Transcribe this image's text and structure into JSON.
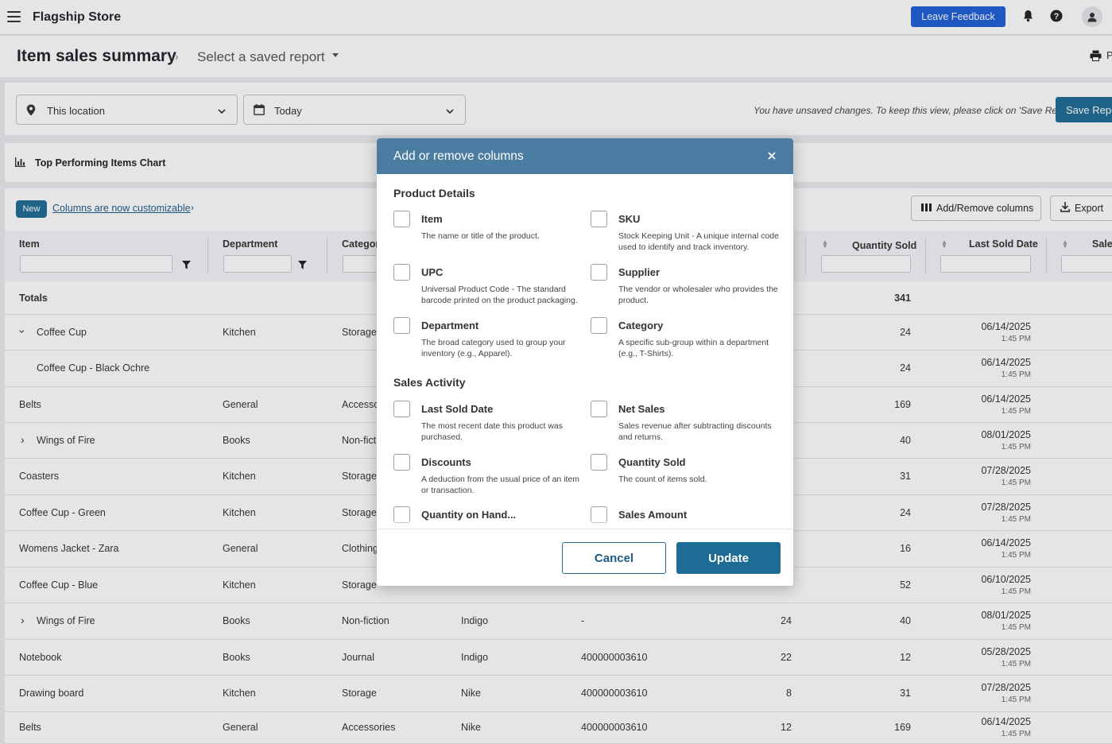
{
  "topbar": {
    "store_name": "Flagship Store",
    "feedback_label": "Leave Feedback",
    "icons": [
      "menu-icon",
      "bell-icon",
      "help-icon",
      "user-icon"
    ]
  },
  "header": {
    "title": "Item sales summary",
    "saved_report": "Select a saved report",
    "print_label": "P"
  },
  "filters": {
    "location": "This location",
    "date": "Today",
    "unsaved_message": "You have unsaved changes. To keep this view, please click on 'Save Report'",
    "save_label": "Save Repo"
  },
  "chart_panel": {
    "label": "Top Performing Items Chart"
  },
  "table": {
    "new_badge": "New",
    "customizable_link": "Columns are now customizable",
    "add_remove_label": "Add/Remove columns",
    "export_label": "Export",
    "columns": {
      "item": "Item",
      "department": "Department",
      "category": "Categor",
      "quantity_sold": "Quantity Sold",
      "last_sold_date": "Last Sold Date",
      "sales": "Sales"
    },
    "totals": {
      "label": "Totals",
      "quantity_sold": "341"
    },
    "rows": [
      {
        "item": "Coffee Cup",
        "department": "Kitchen",
        "category": "Storage",
        "supplier": "",
        "upc": "",
        "qoh": "",
        "qty": "24",
        "date": "06/14/2025",
        "time": "1:45 PM"
      },
      {
        "item": "Coffee Cup - Black Ochre",
        "department": "",
        "category": "",
        "supplier": "",
        "upc": "",
        "qoh": "",
        "qty": "24",
        "date": "06/14/2025",
        "time": "1:45 PM"
      },
      {
        "item": "Belts",
        "department": "General",
        "category": "Accesso",
        "supplier": "",
        "upc": "",
        "qoh": "",
        "qty": "169",
        "date": "06/14/2025",
        "time": "1:45 PM"
      },
      {
        "item": "Wings of Fire",
        "department": "Books",
        "category": "Non-fict",
        "supplier": "",
        "upc": "",
        "qoh": "",
        "qty": "40",
        "date": "08/01/2025",
        "time": "1:45 PM"
      },
      {
        "item": "Coasters",
        "department": "Kitchen",
        "category": "Storage",
        "supplier": "",
        "upc": "",
        "qoh": "",
        "qty": "31",
        "date": "07/28/2025",
        "time": "1:45 PM"
      },
      {
        "item": "Coffee Cup - Green",
        "department": "Kitchen",
        "category": "Storage",
        "supplier": "",
        "upc": "",
        "qoh": "",
        "qty": "24",
        "date": "07/28/2025",
        "time": "1:45 PM"
      },
      {
        "item": "Womens Jacket - Zara",
        "department": "General",
        "category": "Clothing",
        "supplier": "",
        "upc": "",
        "qoh": "",
        "qty": "16",
        "date": "06/14/2025",
        "time": "1:45 PM"
      },
      {
        "item": "Coffee Cup - Blue",
        "department": "Kitchen",
        "category": "Storage",
        "supplier": "",
        "upc": "",
        "qoh": "",
        "qty": "52",
        "date": "06/10/2025",
        "time": "1:45 PM"
      },
      {
        "item": "Wings of Fire",
        "department": "Books",
        "category": "Non-fiction",
        "supplier": "Indigo",
        "upc": "-",
        "qoh": "24",
        "qty": "40",
        "date": "08/01/2025",
        "time": "1:45 PM"
      },
      {
        "item": "Notebook",
        "department": "Books",
        "category": "Journal",
        "supplier": "Indigo",
        "upc": "400000003610",
        "qoh": "22",
        "qty": "12",
        "date": "05/28/2025",
        "time": "1:45 PM"
      },
      {
        "item": "Drawing board",
        "department": "Kitchen",
        "category": "Storage",
        "supplier": "Nike",
        "upc": "400000003610",
        "qoh": "8",
        "qty": "31",
        "date": "07/28/2025",
        "time": "1:45 PM"
      },
      {
        "item": "Belts",
        "department": "General",
        "category": "Accessories",
        "supplier": "Nike",
        "upc": "400000003610",
        "qoh": "12",
        "qty": "169",
        "date": "06/14/2025",
        "time": "1:45 PM"
      }
    ]
  },
  "modal": {
    "title": "Add or remove columns",
    "sections": [
      {
        "title": "Product Details",
        "options": [
          {
            "name": "Item",
            "desc": "The name or title of the product."
          },
          {
            "name": "SKU",
            "desc": "Stock Keeping Unit - A unique internal code used to identify and track inventory."
          },
          {
            "name": "UPC",
            "desc": "Universal Product Code - The standard barcode printed on the product packaging."
          },
          {
            "name": "Supplier",
            "desc": "The vendor or wholesaler who provides the product."
          },
          {
            "name": "Department",
            "desc": "The broad category used to group your inventory (e.g., Apparel)."
          },
          {
            "name": "Category",
            "desc": "A specific sub-group within a department (e.g., T-Shirts)."
          }
        ]
      },
      {
        "title": "Sales Activity",
        "options": [
          {
            "name": "Last Sold Date",
            "desc": "The most recent date this product was purchased."
          },
          {
            "name": "Net Sales",
            "desc": "Sales revenue after subtracting discounts and returns."
          },
          {
            "name": "Discounts",
            "desc": "A deduction from the usual price of an item or transaction."
          },
          {
            "name": "Quantity Sold",
            "desc": "The count of items sold."
          },
          {
            "name": "Quantity on Hand...",
            "desc": ""
          },
          {
            "name": "Sales Amount",
            "desc": ""
          }
        ]
      }
    ],
    "cancel_label": "Cancel",
    "update_label": "Update"
  }
}
